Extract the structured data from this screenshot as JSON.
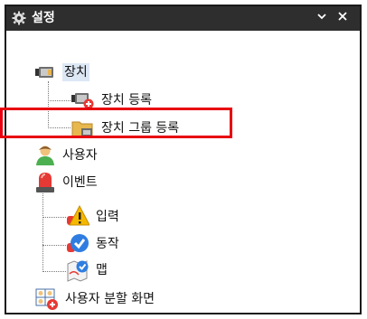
{
  "window": {
    "title": "설정",
    "gear_icon": "gear-icon",
    "dropdown_glyph": "⌄",
    "close_glyph": "✕"
  },
  "tree": {
    "device": {
      "label": "장치",
      "icon": "camera-icon"
    },
    "device_register": {
      "label": "장치 등록",
      "icon": "camera-add-icon"
    },
    "device_group_register": {
      "label": "장치 그룹 등록",
      "icon": "folder-camera-icon"
    },
    "user": {
      "label": "사용자",
      "icon": "user-icon"
    },
    "event": {
      "label": "이벤트",
      "icon": "alarm-siren-icon"
    },
    "event_input": {
      "label": "입력",
      "icon": "warning-siren-icon"
    },
    "event_action": {
      "label": "동작",
      "icon": "check-circle-icon"
    },
    "event_map": {
      "label": "맵",
      "icon": "map-check-icon"
    },
    "user_split_screen": {
      "label": "사용자 분할 화면",
      "icon": "split-screen-user-icon"
    }
  },
  "colors": {
    "titlebar": "#2e2e2e",
    "highlight": "#e8000f",
    "selected": "#dde8f5"
  }
}
